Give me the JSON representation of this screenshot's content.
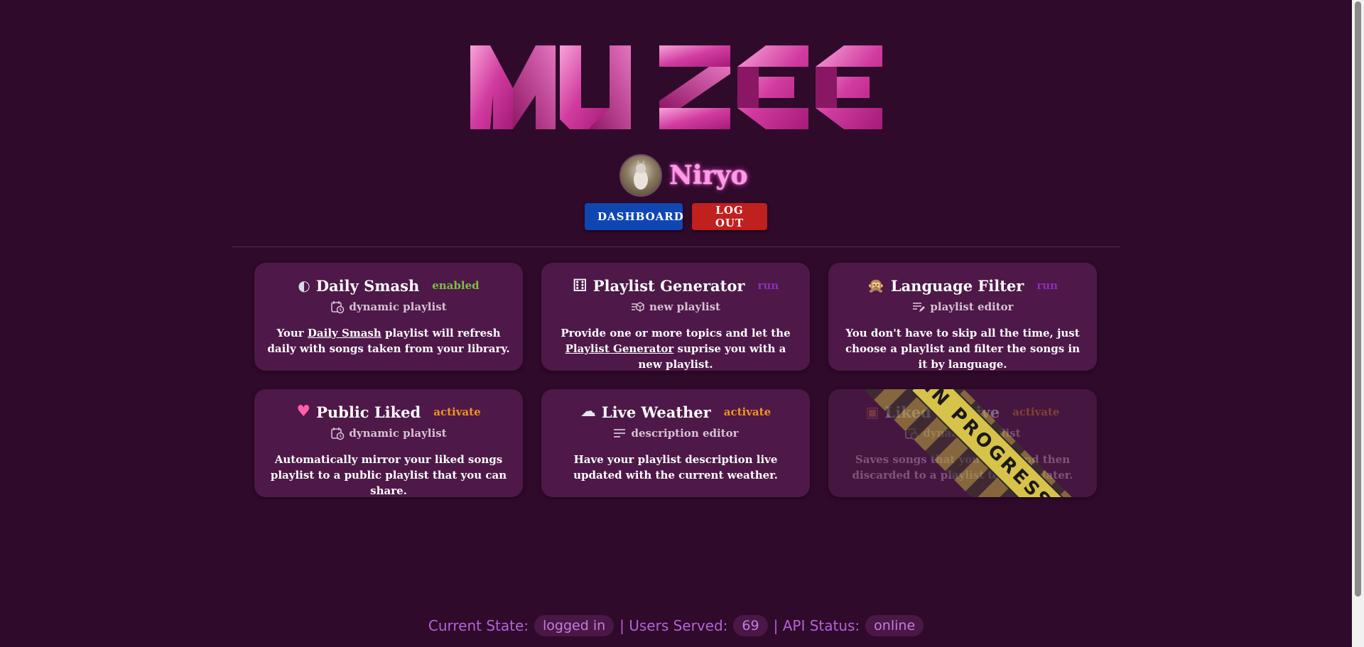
{
  "brand": {
    "logo_text": "MUZEE"
  },
  "profile": {
    "username": "Niryo"
  },
  "header": {
    "dashboard_label": "DASHBOARD",
    "logout_label": "LOG OUT"
  },
  "cards": [
    {
      "icon": "disco-ball-icon",
      "icon_glyph": "◐",
      "title": "Daily Smash",
      "badge": "enabled",
      "badge_color": "#7bc043",
      "sub_icon": "calendar-clock-icon",
      "sub": "dynamic playlist",
      "desc_pre": "Your ",
      "desc_link": "Daily Smash",
      "desc_post": " playlist will refresh daily with songs taken from your library."
    },
    {
      "icon": "dice-icon",
      "icon_glyph": "⚅",
      "title": "Playlist Generator",
      "badge": "run",
      "badge_color": "#8a2fb8",
      "sub_icon": "playlist-add-icon",
      "sub": "new playlist",
      "desc_pre": "Provide one or more topics and let the ",
      "desc_link": "Playlist Generator",
      "desc_post": " suprise you with a new playlist."
    },
    {
      "icon": "monkey-icon",
      "icon_glyph": "🙊",
      "title": "Language Filter",
      "badge": "run",
      "badge_color": "#8a2fb8",
      "sub_icon": "playlist-edit-icon",
      "sub": "playlist editor",
      "desc_pre": "You don't have to skip all the time, just choose a playlist and filter the songs in it by language.",
      "desc_link": "",
      "desc_post": ""
    },
    {
      "icon": "heart-icon",
      "icon_glyph": "♥",
      "title": "Public Liked",
      "badge": "activate",
      "badge_color": "#f0961c",
      "sub_icon": "calendar-clock-icon",
      "sub": "dynamic playlist",
      "desc_pre": "Automatically mirror your liked songs playlist to a public playlist that you can share.",
      "desc_link": "",
      "desc_post": ""
    },
    {
      "icon": "rain-cloud-icon",
      "icon_glyph": "☁",
      "title": "Live Weather",
      "badge": "activate",
      "badge_color": "#f0961c",
      "sub_icon": "text-lines-icon",
      "sub": "description editor",
      "desc_pre": "Have your playlist description live updated with the current weather.",
      "desc_link": "",
      "desc_post": ""
    },
    {
      "icon": "box-icon",
      "icon_glyph": "▣",
      "title": "Liked Archive",
      "badge": "activate",
      "badge_color": "#f0961c",
      "sub_icon": "calendar-clock-icon",
      "sub": "dynamic playlist",
      "desc_pre": "Saves songs that you liked and then discarded to a playlist to check later.",
      "desc_link": "",
      "desc_post": "",
      "tape_text": "IN PROGRESS"
    }
  ],
  "footer": {
    "state_label": "Current State:",
    "state_value": "logged in",
    "users_label": "| Users Served:",
    "users_value": "69",
    "api_label": "| API Status:",
    "api_value": "online"
  },
  "colors": {
    "background": "#2f0a2b",
    "card": "#4e1848",
    "accent_pink": "#ff9ce8",
    "dashboard_button": "#1046b2",
    "logout_button": "#c0201e"
  }
}
